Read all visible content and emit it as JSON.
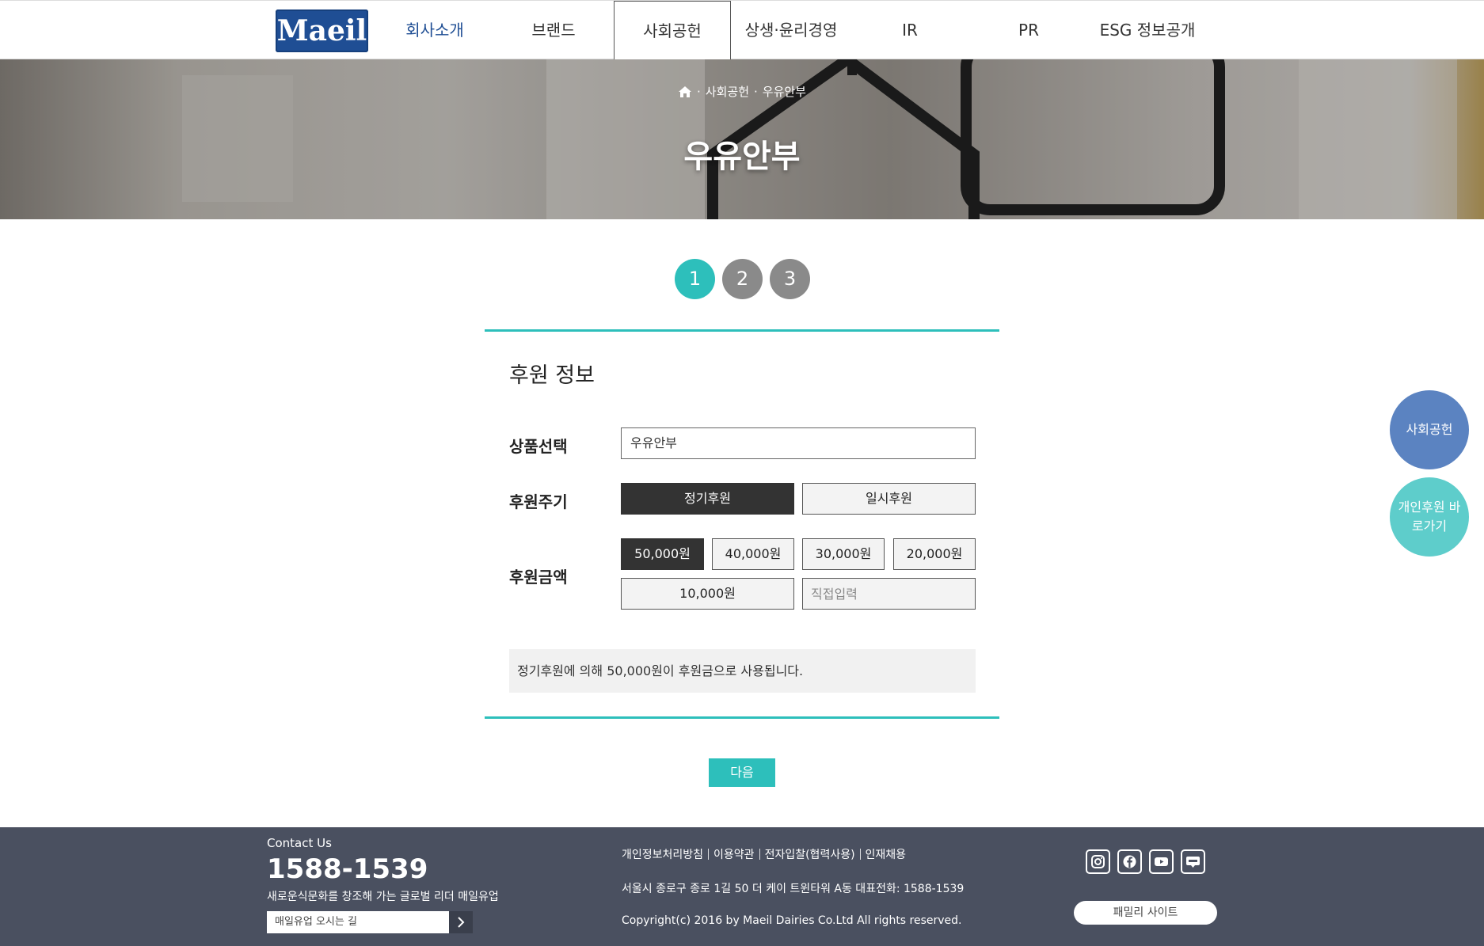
{
  "header": {
    "logo_text": "Maeil",
    "nav": [
      {
        "label": "회사소개"
      },
      {
        "label": "브랜드"
      },
      {
        "label": "사회공헌"
      },
      {
        "label": "상생·윤리경영"
      },
      {
        "label": "IR"
      },
      {
        "label": "PR"
      },
      {
        "label": "ESG 정보공개"
      }
    ]
  },
  "hero": {
    "breadcrumb": [
      "사회공헌",
      "우유안부"
    ],
    "breadcrumb_sep": "·",
    "title": "우유안부",
    "home_icon": "home-icon"
  },
  "steps": [
    "1",
    "2",
    "3"
  ],
  "form": {
    "section_title": "후원 정보",
    "product_label": "상품선택",
    "product_value": "우유안부",
    "cycle_label": "후원주기",
    "cycle_options": [
      "정기후원",
      "일시후원"
    ],
    "cycle_selected": "정기후원",
    "amount_label": "후원금액",
    "amount_options": [
      "50,000원",
      "40,000원",
      "30,000원",
      "20,000원",
      "10,000원"
    ],
    "amount_selected": "50,000원",
    "direct_placeholder": "직접입력",
    "summary": "정기후원에 의해  50,000원이 후원금으로 사용됩니다.",
    "next_label": "다음"
  },
  "floating": {
    "social_label": "사회공헌",
    "personal_label": "개인후원 바로가기"
  },
  "footer": {
    "contact_label": "Contact Us",
    "phone": "1588-1539",
    "slogan": "새로운식문화를 창조해 가는 글로벌 리더 매일유업",
    "directions": "매일유업 오시는 길",
    "links": [
      "개인정보처리방침",
      "이용약관",
      "전자입찰(협력사용)",
      "인재채용"
    ],
    "address": "서울시 종로구 종로 1길 50 더 케이 트윈타워 A동 대표전화: 1588-1539",
    "copyright": "Copyright(c) 2016 by Maeil Dairies Co.Ltd All rights reserved.",
    "social_icons": [
      "instagram-icon",
      "facebook-icon",
      "youtube-icon",
      "blog-icon"
    ],
    "family_site": "패밀리 사이트"
  },
  "colors": {
    "accent": "#2dbfbb",
    "brand": "#1f4e94",
    "dark_selected": "#333333",
    "footer_bg": "#4a5060",
    "float_blue": "#5b83c1",
    "float_teal": "#5ecdcb"
  }
}
